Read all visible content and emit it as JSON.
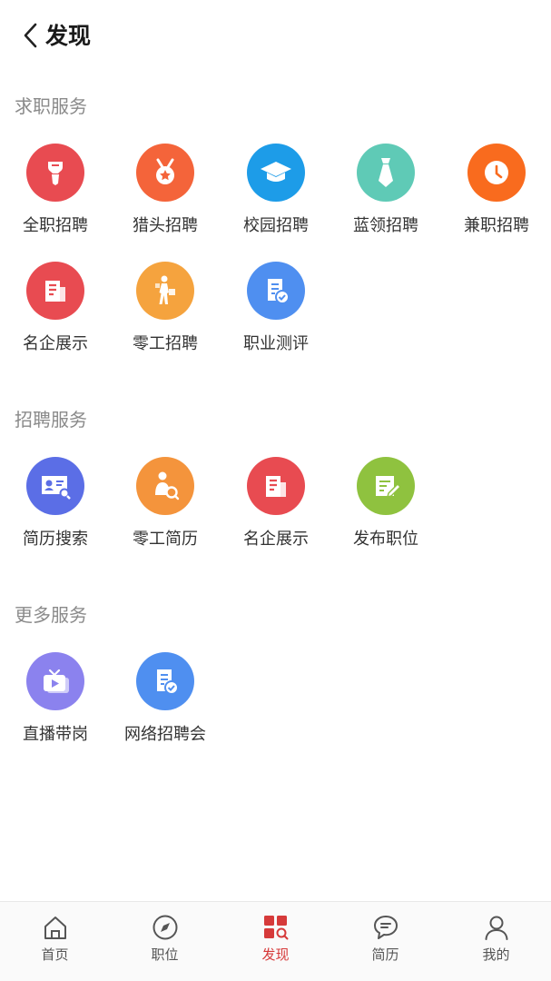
{
  "header": {
    "title": "发现"
  },
  "sections": [
    {
      "title": "求职服务",
      "items": [
        {
          "label": "全职招聘",
          "icon": "tie-badge-icon",
          "color": "#e84b51"
        },
        {
          "label": "猎头招聘",
          "icon": "medal-icon",
          "color": "#f4643a"
        },
        {
          "label": "校园招聘",
          "icon": "graduation-cap-icon",
          "color": "#1d9ce8"
        },
        {
          "label": "蓝领招聘",
          "icon": "necktie-icon",
          "color": "#5fcab6"
        },
        {
          "label": "兼职招聘",
          "icon": "clock-icon",
          "color": "#f96b1e"
        },
        {
          "label": "名企展示",
          "icon": "company-building-icon",
          "color": "#e84b51"
        },
        {
          "label": "零工招聘",
          "icon": "worker-icon",
          "color": "#f5a33e"
        },
        {
          "label": "职业测评",
          "icon": "assessment-doc-icon",
          "color": "#4f8ff0"
        }
      ]
    },
    {
      "title": "招聘服务",
      "items": [
        {
          "label": "简历搜索",
          "icon": "resume-search-icon",
          "color": "#5b6ee6"
        },
        {
          "label": "零工简历",
          "icon": "worker-search-icon",
          "color": "#f4943c"
        },
        {
          "label": "名企展示",
          "icon": "company-building-icon",
          "color": "#e84b51"
        },
        {
          "label": "发布职位",
          "icon": "edit-doc-icon",
          "color": "#8fc23f"
        }
      ]
    },
    {
      "title": "更多服务",
      "items": [
        {
          "label": "直播带岗",
          "icon": "live-tv-icon",
          "color": "#8b82ee"
        },
        {
          "label": "网络招聘会",
          "icon": "online-fair-doc-icon",
          "color": "#4f8ff0"
        }
      ]
    }
  ],
  "bottom_nav": [
    {
      "label": "首页",
      "icon": "home-icon",
      "active": false
    },
    {
      "label": "职位",
      "icon": "compass-icon",
      "active": false
    },
    {
      "label": "发现",
      "icon": "discover-grid-icon",
      "active": true
    },
    {
      "label": "简历",
      "icon": "chat-bubble-icon",
      "active": false
    },
    {
      "label": "我的",
      "icon": "user-icon",
      "active": false
    }
  ],
  "colors": {
    "accent": "#d63a3a",
    "section_title": "#8a8a8a"
  }
}
